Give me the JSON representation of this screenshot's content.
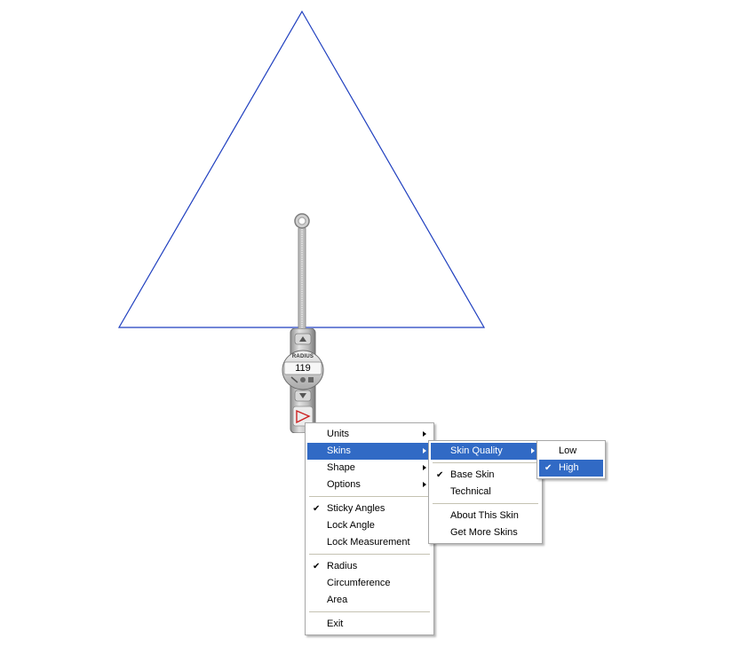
{
  "widget": {
    "label": "RADIUS",
    "value": "119"
  },
  "main_menu": {
    "items": [
      {
        "label": "Units",
        "submenu": true
      },
      {
        "label": "Skins",
        "submenu": true,
        "highlighted": true
      },
      {
        "label": "Shape",
        "submenu": true
      },
      {
        "label": "Options",
        "submenu": true
      },
      {
        "label": "Sticky Angles",
        "checked": true
      },
      {
        "label": "Lock Angle"
      },
      {
        "label": "Lock Measurement"
      },
      {
        "label": "Radius",
        "checked": true
      },
      {
        "label": "Circumference"
      },
      {
        "label": "Area"
      },
      {
        "label": "Exit"
      }
    ]
  },
  "skins_menu": {
    "items": [
      {
        "label": "Skin Quality",
        "submenu": true,
        "highlighted": true
      },
      {
        "label": "Base Skin",
        "checked": true
      },
      {
        "label": "Technical"
      },
      {
        "label": "About This Skin"
      },
      {
        "label": "Get More Skins"
      }
    ]
  },
  "quality_menu": {
    "items": [
      {
        "label": "Low"
      },
      {
        "label": "High",
        "checked": true,
        "highlighted": true
      }
    ]
  },
  "colors": {
    "triangle_stroke": "#1f3fbf",
    "highlight": "#316ac5",
    "menu_border": "#a7a7a7"
  },
  "icons": [
    "check-icon",
    "submenu-arrow-icon",
    "up-arrow-icon",
    "down-arrow-icon",
    "skin-icon"
  ]
}
